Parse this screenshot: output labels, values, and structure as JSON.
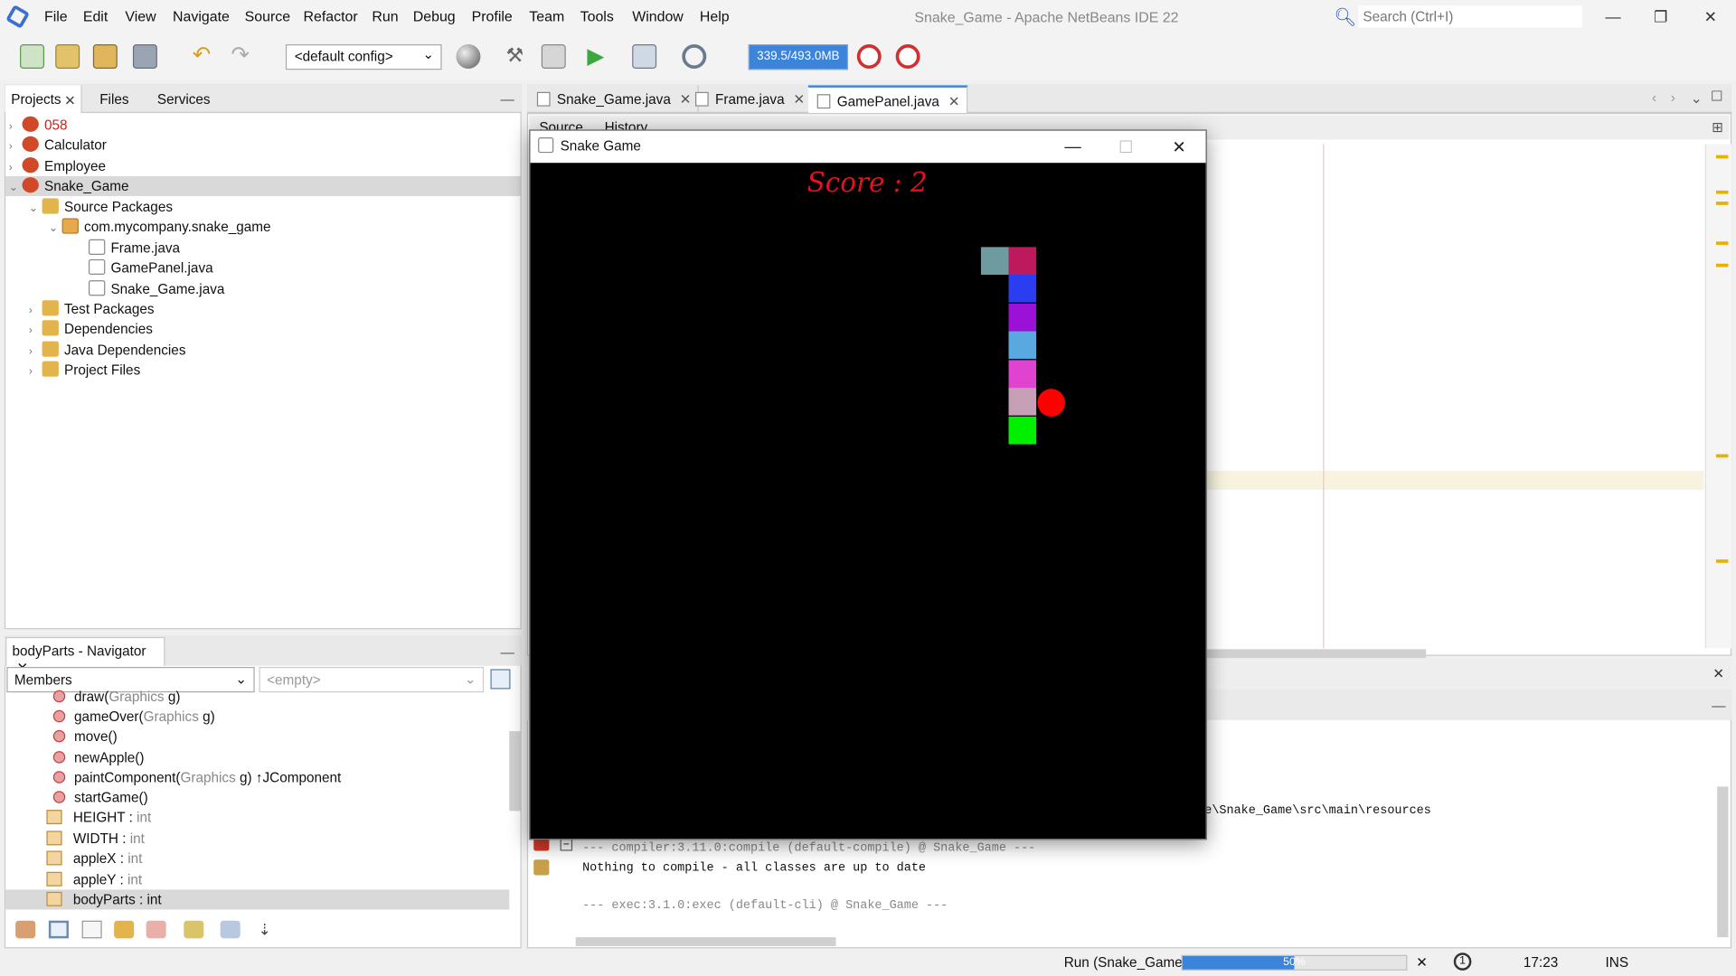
{
  "menu": [
    "File",
    "Edit",
    "View",
    "Navigate",
    "Source",
    "Refactor",
    "Run",
    "Debug",
    "Profile",
    "Team",
    "Tools",
    "Window",
    "Help"
  ],
  "app_title": "Snake_Game - Apache NetBeans IDE 22",
  "search_placeholder": "Search (Ctrl+I)",
  "toolbar": {
    "config": "<default config>",
    "memory": "339.5/493.0MB"
  },
  "projects_tabs": [
    "Projects",
    "Files",
    "Services"
  ],
  "tree": {
    "p058": "058",
    "calculator": "Calculator",
    "employee": "Employee",
    "snake_game": "Snake_Game",
    "source_packages": "Source Packages",
    "package": "com.mycompany.snake_game",
    "files": [
      "Frame.java",
      "GamePanel.java",
      "Snake_Game.java"
    ],
    "test_packages": "Test Packages",
    "dependencies": "Dependencies",
    "java_dependencies": "Java Dependencies",
    "project_files": "Project Files"
  },
  "navigator": {
    "title": "bodyParts - Navigator",
    "members_select": "Members",
    "filter_select": "<empty>",
    "methods": [
      {
        "name": "draw(",
        "param": "Graphics",
        "tail": " g)"
      },
      {
        "name": "gameOver(",
        "param": "Graphics",
        "tail": " g)"
      },
      {
        "name": "move()",
        "param": "",
        "tail": ""
      },
      {
        "name": "newApple()",
        "param": "",
        "tail": ""
      },
      {
        "name": "paintComponent(",
        "param": "Graphics",
        "tail": " g) ↑JComponent"
      },
      {
        "name": "startGame()",
        "param": "",
        "tail": ""
      }
    ],
    "fields": [
      {
        "name": "HEIGHT",
        "type": "int"
      },
      {
        "name": "WIDTH",
        "type": "int"
      },
      {
        "name": "appleX",
        "type": "int"
      },
      {
        "name": "appleY",
        "type": "int"
      },
      {
        "name": "bodyParts",
        "type": "int"
      }
    ]
  },
  "editor_tabs": [
    "Snake_Game.java",
    "Frame.java",
    "GamePanel.java"
  ],
  "editor_subtabs": [
    "Source",
    "History"
  ],
  "output": {
    "path_tail": "e\\Snake_Game\\src\\main\\resources",
    "line1": "--- compiler:3.11.0:compile (default-compile) @ Snake_Game ---",
    "line2": "Nothing to compile - all classes are up to date",
    "line3": "--- exec:3.1.0:exec (default-cli) @ Snake_Game ---"
  },
  "status": {
    "run": "Run (Snake_Game)",
    "progress_text": "50%",
    "progress": 0.5,
    "time": "17:23",
    "mode": "INS"
  },
  "game": {
    "title": "Snake Game",
    "score_label": "Score : 2",
    "colors": {
      "bg": "#000000",
      "apple": "#ff0000",
      "score": "#e3121e"
    },
    "segments": [
      "#6e9ba0",
      "#bd1a5e",
      "#2b3df0",
      "#9b12d6",
      "#5aa8e0",
      "#e043cf",
      "#c7a0b8",
      "#00f000"
    ]
  }
}
